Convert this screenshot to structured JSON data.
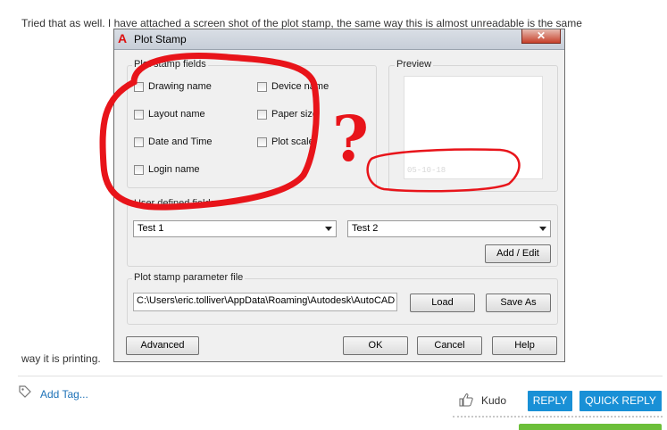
{
  "post": {
    "text_line1": "Tried that as well. I have attached a screen shot of the plot stamp, the same way this is almost unreadable is the same",
    "text_line2": "way it is printing."
  },
  "dialog": {
    "title": "Plot Stamp",
    "close_label": "✕",
    "fields_group_label": "Plot stamp fields",
    "fields": [
      {
        "label": "Drawing name",
        "checked": false
      },
      {
        "label": "Device name",
        "checked": false
      },
      {
        "label": "Layout name",
        "checked": false
      },
      {
        "label": "Paper size",
        "checked": false
      },
      {
        "label": "Date and Time",
        "checked": false
      },
      {
        "label": "Plot scale",
        "checked": false
      },
      {
        "label": "Login name",
        "checked": false
      }
    ],
    "preview_label": "Preview",
    "preview_stamp_text": "05-10-18",
    "user_defined_label": "User defined fields",
    "user_field_1": "Test 1",
    "user_field_2": "Test 2",
    "add_edit_label": "Add / Edit",
    "param_file_label": "Plot stamp parameter file",
    "param_file_path": "C:\\Users\\eric.tolliver\\AppData\\Roaming\\Autodesk\\AutoCAD",
    "load_label": "Load",
    "save_as_label": "Save As",
    "advanced_label": "Advanced",
    "ok_label": "OK",
    "cancel_label": "Cancel",
    "help_label": "Help",
    "annotation_question": "?"
  },
  "footer": {
    "add_tag_label": "Add Tag...",
    "kudo_label": "Kudo",
    "reply_label": "REPLY",
    "quick_reply_label": "QUICK REPLY"
  },
  "colors": {
    "accent_blue": "#1990d6",
    "link_blue": "#1d72b8",
    "annotation_red": "#e8141a",
    "autocad_red": "#dd1111"
  }
}
